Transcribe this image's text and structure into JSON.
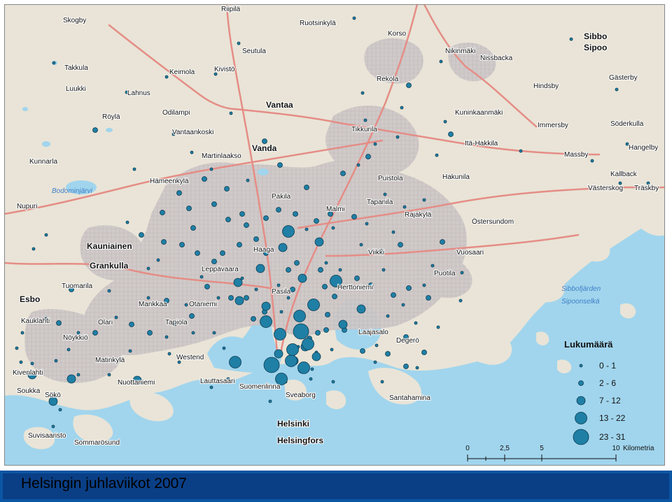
{
  "title": "Helsingin juhlaviikot 2007",
  "colors": {
    "sea": "#9fd4ec",
    "land": "#e9e4d7",
    "urban": "#cdc7c7",
    "road": "#e88a84",
    "symbol": "#1f7fa4",
    "title_bar": "#0b56a4"
  },
  "legend": {
    "title": "Lukumäärä",
    "classes": [
      {
        "label": "0 - 1",
        "size": "1"
      },
      {
        "label": "2 - 6",
        "size": "2"
      },
      {
        "label": "7 - 12",
        "size": "3"
      },
      {
        "label": "13 - 22",
        "size": "4"
      },
      {
        "label": "23 - 31",
        "size": "5"
      }
    ]
  },
  "scale": {
    "ticks": [
      "0",
      "2,5",
      "5",
      "10"
    ],
    "unit": "Kilometria"
  },
  "places": [
    {
      "name": "Riipilä"
    },
    {
      "name": "Skogby"
    },
    {
      "name": "Ruotsinkylä"
    },
    {
      "name": "Korso"
    },
    {
      "name": "Sibbo"
    },
    {
      "name": "Sipoo"
    },
    {
      "name": "Seutula"
    },
    {
      "name": "Nikinmäki"
    },
    {
      "name": "Nissbacka"
    },
    {
      "name": "Takkula"
    },
    {
      "name": "Keimola"
    },
    {
      "name": "Kivistö"
    },
    {
      "name": "Rekola"
    },
    {
      "name": "Gästerby"
    },
    {
      "name": "Luukki"
    },
    {
      "name": "Lahnus"
    },
    {
      "name": "Hindsby"
    },
    {
      "name": "Vantaa"
    },
    {
      "name": "Odilampi"
    },
    {
      "name": "Kuninkaanmäki"
    },
    {
      "name": "Röylä"
    },
    {
      "name": "Immersby"
    },
    {
      "name": "Söderkulla"
    },
    {
      "name": "Vantaankoski"
    },
    {
      "name": "Tikkurila"
    },
    {
      "name": "Itä-Hakkila"
    },
    {
      "name": "Vanda"
    },
    {
      "name": "Hangelby"
    },
    {
      "name": "Martinlaakso"
    },
    {
      "name": "Massby"
    },
    {
      "name": "Kunnarla"
    },
    {
      "name": "Kallback"
    },
    {
      "name": "Hämeenkylä"
    },
    {
      "name": "Puistola"
    },
    {
      "name": "Hakunila"
    },
    {
      "name": "Västerskog"
    },
    {
      "name": "Träskby"
    },
    {
      "name": "Bodominjärvi"
    },
    {
      "name": "Pakila"
    },
    {
      "name": "Tapanila"
    },
    {
      "name": "Nupuri"
    },
    {
      "name": "Malmi"
    },
    {
      "name": "Rajakylä"
    },
    {
      "name": "Östersundom"
    },
    {
      "name": "Kauniainen"
    },
    {
      "name": "Haaga"
    },
    {
      "name": "Viikki"
    },
    {
      "name": "Vuosaari"
    },
    {
      "name": "Grankulla"
    },
    {
      "name": "Leppävaara"
    },
    {
      "name": "Puotila"
    },
    {
      "name": "Tuomarila"
    },
    {
      "name": "Herttoniemi"
    },
    {
      "name": "Sibbofjärden"
    },
    {
      "name": "Pasila"
    },
    {
      "name": "Sipoonselkä"
    },
    {
      "name": "Esbo"
    },
    {
      "name": "Mankkaa"
    },
    {
      "name": "Otaniemi"
    },
    {
      "name": "Kauklahti"
    },
    {
      "name": "Olari"
    },
    {
      "name": "Tapiola"
    },
    {
      "name": "Laajasalo"
    },
    {
      "name": "Nöykkiö"
    },
    {
      "name": "Degerö"
    },
    {
      "name": "Matinkylä"
    },
    {
      "name": "Westend"
    },
    {
      "name": "Kivenlahti"
    },
    {
      "name": "Nuottaniemi"
    },
    {
      "name": "Lauttasaari"
    },
    {
      "name": "Suomenlinna"
    },
    {
      "name": "Soukka"
    },
    {
      "name": "Sökö"
    },
    {
      "name": "Sveaborg"
    },
    {
      "name": "Santahamina"
    },
    {
      "name": "Helsinki"
    },
    {
      "name": "Suvisaaristo"
    },
    {
      "name": "Sommarösund"
    },
    {
      "name": "Helsingfors"
    }
  ],
  "symbols_by_class": {
    "1": 96,
    "2": 72,
    "3": 18,
    "4": 12,
    "5": 2
  }
}
